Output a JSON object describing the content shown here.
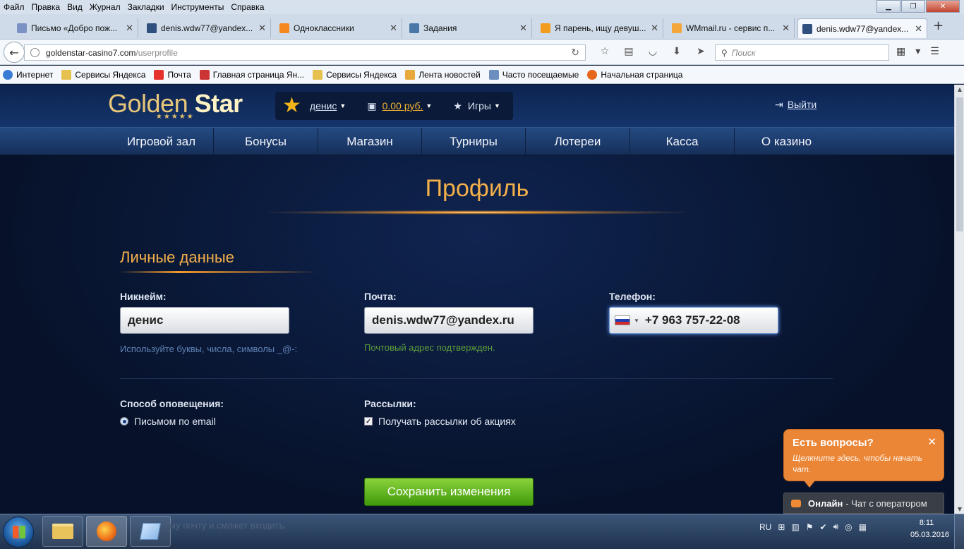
{
  "browser": {
    "menu": [
      "Файл",
      "Правка",
      "Вид",
      "Журнал",
      "Закладки",
      "Инструменты",
      "Справка"
    ],
    "tabs": [
      {
        "label": "Письмо «Добро пож...",
        "icon": "mail-icon",
        "color": "#7b93c4"
      },
      {
        "label": "denis.wdw77@yandex...",
        "icon": "gs-icon",
        "color": "#2f4f7f"
      },
      {
        "label": "Одноклассники",
        "icon": "ok-icon",
        "color": "#f5881f"
      },
      {
        "label": "Задания",
        "icon": "vk-icon",
        "color": "#4a76a8"
      },
      {
        "label": "Я парень, ищу девуш...",
        "icon": "mamba-icon",
        "color": "#f29b1d"
      },
      {
        "label": "WMmail.ru - сервис п...",
        "icon": "wmmail-icon",
        "color": "#f4a63a"
      },
      {
        "label": "denis.wdw77@yandex...",
        "icon": "gs-icon",
        "color": "#2f4f7f"
      }
    ],
    "url": {
      "host": "goldenstar-casino7.com",
      "path": "/userprofile"
    },
    "search_placeholder": "Поиск",
    "bookmarks": [
      {
        "label": "Интернет",
        "icon": "globe-icon",
        "color": "#3a7bd5"
      },
      {
        "label": "Сервисы Яндекса",
        "icon": "folder-icon",
        "color": "#e6c14f"
      },
      {
        "label": "Почта",
        "icon": "yandex-mail-icon",
        "color": "#e5322d"
      },
      {
        "label": "Главная страница Ян...",
        "icon": "yandex-icon",
        "color": "#cc3333"
      },
      {
        "label": "Сервисы Яндекса",
        "icon": "folder-icon",
        "color": "#e6c14f"
      },
      {
        "label": "Лента новостей",
        "icon": "news-icon",
        "color": "#e7a93b"
      },
      {
        "label": "Часто посещаемые",
        "icon": "history-icon",
        "color": "#6d8fbf"
      },
      {
        "label": "Начальная страница",
        "icon": "firefox-icon",
        "color": "#e8661c"
      }
    ]
  },
  "site": {
    "logo": {
      "gold": "Golden ",
      "star": "Star",
      "stars": "★★★★★"
    },
    "user": {
      "name": "денис",
      "balance": "0.00 руб.",
      "games": "Игры"
    },
    "logout": "Выйти",
    "menu": [
      "Игровой зал",
      "Бонусы",
      "Магазин",
      "Турниры",
      "Лотереи",
      "Касса",
      "О казино"
    ],
    "page_title": "Профиль",
    "section_title": "Личные данные",
    "fields": {
      "nickname": {
        "label": "Никнейм:",
        "value": "денис",
        "hint": "Используйте буквы, числа, символы _@-:"
      },
      "email": {
        "label": "Почта:",
        "value": "denis.wdw77@yandex.ru",
        "hint": "Почтовый адрес подтвержден."
      },
      "phone": {
        "label": "Телефон:",
        "value": "+7 963 757-22-08"
      }
    },
    "notify": {
      "label": "Способ оповещения:",
      "option": "Письмом по email"
    },
    "mailing": {
      "label": "Рассылки:",
      "option": "Получать рассылки об акциях"
    },
    "save": "Сохранить изменения",
    "chat": {
      "title": "Есть вопросы?",
      "subtitle": "Щелкните здесь, чтобы начать чат.",
      "online": "Онлайн",
      "operator": "- Чат с оператором"
    },
    "colors": {
      "accent": "#f4b04a",
      "hint_blue": "#5f82b4",
      "hint_green": "#5c9e3a",
      "save": "#5bb51f",
      "chat": "#eb8637"
    }
  },
  "taskbar": {
    "ghost_text": "му почту и сможет входить.",
    "lang": "RU",
    "time": "8:11",
    "date": "05.03.2016"
  }
}
